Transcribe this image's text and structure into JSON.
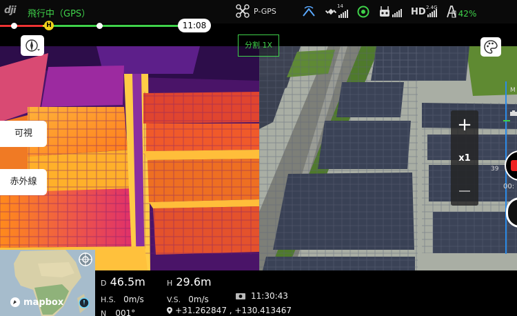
{
  "topbar": {
    "logo": "dji",
    "flight_status": "飛行中（GPS）",
    "mode": "P-GPS",
    "satellite_count": "14",
    "hd_signal_label": "HD",
    "hd_freq": "2.4G",
    "battery_percent": "42%"
  },
  "flight_bar": {
    "home_marker": "H",
    "remaining_time": "11:08"
  },
  "camera": {
    "split_label": "分割 1X",
    "zoom_level": "x1",
    "zoom_plus": "+",
    "rail_label_top": "M",
    "rail_counter": "39",
    "rec_time": "00:"
  },
  "side_buttons": {
    "visible": "可視",
    "infrared": "赤外線"
  },
  "map": {
    "brand": "mapbox"
  },
  "telemetry": {
    "distance_label": "D",
    "distance": "46.5m",
    "height_label": "H",
    "height": "29.6m",
    "hs_label": "H.S.",
    "hs_value": "0m/s",
    "vs_label": "V.S.",
    "vs_value": "0m/s",
    "time": "11:30:43",
    "heading_label": "N",
    "heading": "001°",
    "coordinates": "+31.262847 , +130.413467"
  },
  "colors": {
    "accent_green": "#3fd24a",
    "warning_red": "#e33333",
    "home_yellow": "#f2d21c",
    "rail_blue": "#2b8be8"
  },
  "icons": [
    "drone-icon",
    "signal-icon",
    "satellite-icon",
    "vision-icon",
    "remote-controller-icon",
    "hd-link-icon",
    "battery-icon",
    "compass-icon",
    "palette-icon",
    "map-target-icon",
    "camera-icon",
    "location-pin-icon",
    "info-icon"
  ]
}
